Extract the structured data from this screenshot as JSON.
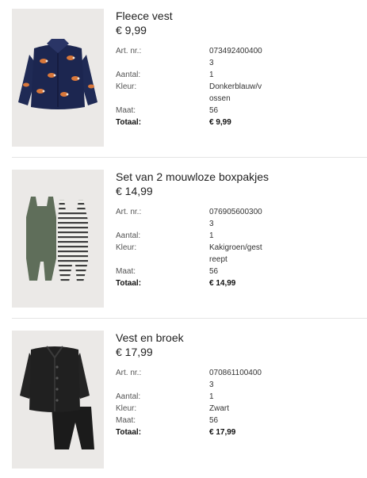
{
  "items": [
    {
      "name": "Fleece vest",
      "price": "€ 9,99",
      "image_icon": "navy-fox-print-fleece-jacket",
      "details": {
        "art_label": "Art. nr.:",
        "art_value": "0734924004003",
        "qty_label": "Aantal:",
        "qty_value": "1",
        "color_label": "Kleur:",
        "color_value": "Donkerblauw/vossen",
        "size_label": "Maat:",
        "size_value": "56",
        "total_label": "Totaal:",
        "total_value": "€ 9,99"
      }
    },
    {
      "name": "Set van 2 mouwloze boxpakjes",
      "price": "€ 14,99",
      "image_icon": "two-sleeveless-rompers-khaki-and-stripes",
      "details": {
        "art_label": "Art. nr.:",
        "art_value": "0769056003003",
        "qty_label": "Aantal:",
        "qty_value": "1",
        "color_label": "Kleur:",
        "color_value": "Kakigroen/gestreept",
        "size_label": "Maat:",
        "size_value": "56",
        "total_label": "Totaal:",
        "total_value": "€ 14,99"
      }
    },
    {
      "name": "Vest en broek",
      "price": "€ 17,99",
      "image_icon": "black-cardigan-and-trousers-set",
      "details": {
        "art_label": "Art. nr.:",
        "art_value": "0708611004003",
        "qty_label": "Aantal:",
        "qty_value": "1",
        "color_label": "Kleur:",
        "color_value": "Zwart",
        "size_label": "Maat:",
        "size_value": "56",
        "total_label": "Totaal:",
        "total_value": "€ 17,99"
      }
    }
  ]
}
